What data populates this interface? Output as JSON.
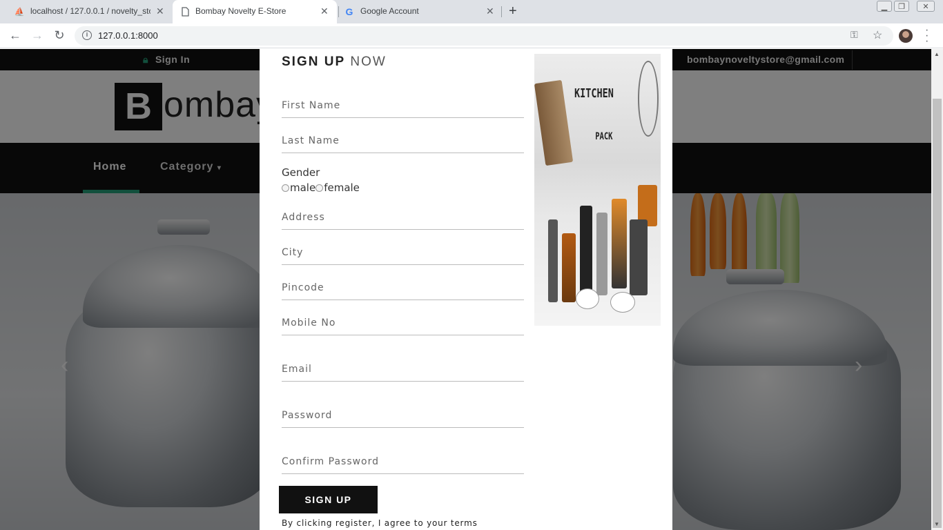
{
  "browser": {
    "tabs": [
      {
        "title": "localhost / 127.0.0.1 / novelty_sto",
        "icon": "phpmyadmin-icon",
        "active": false
      },
      {
        "title": "Bombay Novelty E-Store",
        "icon": "page-icon",
        "active": true
      },
      {
        "title": "Google Account",
        "icon": "google-icon",
        "active": false
      }
    ],
    "new_tab": "+",
    "url": "127.0.0.1:8000"
  },
  "site": {
    "sign_in": "Sign In",
    "email": "bombaynoveltystore@gmail.com",
    "logo_letter": "B",
    "logo_rest": "ombay",
    "nav": {
      "home": "Home",
      "category": "Category"
    }
  },
  "modal": {
    "title_bold": "SIGN UP",
    "title_light": "NOW",
    "fields": {
      "first_name": "First Name",
      "last_name": "Last Name",
      "address": "Address",
      "city": "City",
      "pincode": "Pincode",
      "mobile": "Mobile No",
      "email": "Email",
      "password": "Password",
      "confirm_password": "Confirm Password"
    },
    "gender_label": "Gender",
    "gender_options": {
      "male": "male",
      "female": "female"
    },
    "submit": "SIGN UP",
    "terms": "By clicking register, I agree to your terms",
    "image_text_1": "KITCHEN",
    "image_text_2": "PACK"
  },
  "colors": {
    "accent": "#25a07a",
    "dark": "#111111"
  }
}
